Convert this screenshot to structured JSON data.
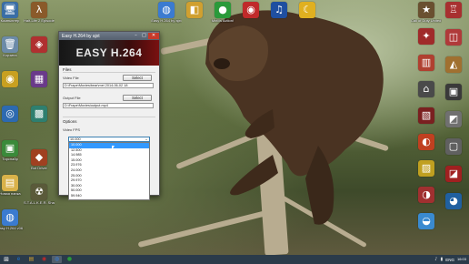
{
  "window": {
    "title": "Easy H.264 by ajxt",
    "banner_text": "EASY H.264",
    "minimize_glyph": "–",
    "maximize_glyph": "□",
    "close_glyph": "✕",
    "files_group": "Files",
    "video_file_label": "Video File",
    "video_file_value": "D:\\Frape\\Movies\\bear\\mei 2014-06-02 18",
    "select_label": "Select",
    "output_file_label": "Output File",
    "output_file_value": "D:\\Frape\\Movies\\output.mp4",
    "options_group": "Options",
    "video_fps_label": "Video FPS",
    "fps_selected": "10.000",
    "fps_arrow": "⌄",
    "fps_options": [
      "10.000",
      "12.500",
      "14.985",
      "15.000",
      "23.976",
      "24.000",
      "25.000",
      "29.970",
      "30.000",
      "50.000",
      "59.940"
    ],
    "fps_highlight_index": 0
  },
  "desktop": {
    "left_icons": [
      {
        "label": "Компьютер",
        "glyph": "🖥",
        "color": "#3a6ea5",
        "icon": "computer-icon"
      },
      {
        "label": "Корзина",
        "glyph": "🗑",
        "color": "#6c8ba8",
        "icon": "recycle-bin-icon"
      },
      {
        "label": "",
        "glyph": "◉",
        "color": "#c8a020",
        "icon": "app-icon"
      },
      {
        "label": "",
        "glyph": "◎",
        "color": "#2d6ab0",
        "icon": "app-icon"
      },
      {
        "label": "Тирснайр",
        "glyph": "▣",
        "color": "#3a8a3a",
        "icon": "app-icon"
      },
      {
        "label": "Новая папка",
        "glyph": "▤",
        "color": "#d9b24a",
        "icon": "folder-icon"
      },
      {
        "label": "Easy H.264 v06",
        "glyph": "◍",
        "color": "#3b7bd0",
        "icon": "easy-h264-icon"
      }
    ],
    "left_icons_col2": [
      {
        "label": "Half-Life 2 Episode...",
        "glyph": "λ",
        "color": "#8a5a2a",
        "icon": "game-icon"
      },
      {
        "label": "",
        "glyph": "◈",
        "color": "#b03030",
        "icon": "app-icon"
      },
      {
        "label": "",
        "glyph": "▦",
        "color": "#6a3a8a",
        "icon": "app-icon"
      },
      {
        "label": "",
        "glyph": "▩",
        "color": "#2f7f6f",
        "icon": "app-icon"
      },
      {
        "label": "Bot Driver",
        "glyph": "◆",
        "color": "#a04020",
        "icon": "app-icon"
      },
      {
        "label": "S.T.A.L.K.E.R. Shadow of...",
        "glyph": "☢",
        "color": "#5a5a3a",
        "icon": "game-icon"
      }
    ],
    "top_icons": [
      {
        "label": "Easy H.264 by ajxt",
        "glyph": "◍",
        "color": "#3b7bd0",
        "icon": "easy-h264-icon"
      },
      {
        "label": "",
        "glyph": "◧",
        "color": "#d0a030",
        "icon": "app-icon"
      },
      {
        "label": "Mirillis Action!",
        "glyph": "●",
        "color": "#2a9a3a",
        "icon": "recorder-icon"
      },
      {
        "label": "",
        "glyph": "◉",
        "color": "#c02a2a",
        "icon": "app-icon"
      },
      {
        "label": "",
        "glyph": "♫",
        "color": "#1f4fa0",
        "icon": "media-icon"
      },
      {
        "label": "",
        "glyph": "☾",
        "color": "#e0b020",
        "icon": "app-icon"
      }
    ],
    "right_icons": [
      {
        "label": "Call of Duty United Offen...",
        "glyph": "★",
        "color": "#6a5030",
        "icon": "game-icon"
      },
      {
        "label": "",
        "glyph": "✦",
        "color": "#a02a2a",
        "icon": "game-icon"
      },
      {
        "label": "",
        "glyph": "▥",
        "color": "#b04030",
        "icon": "app-icon"
      },
      {
        "label": "",
        "glyph": "⌂",
        "color": "#4a4a4a",
        "icon": "app-icon"
      },
      {
        "label": "",
        "glyph": "▧",
        "color": "#7a2020",
        "icon": "app-icon"
      },
      {
        "label": "",
        "glyph": "◐",
        "color": "#c04020",
        "icon": "app-icon"
      },
      {
        "label": "",
        "glyph": "▨",
        "color": "#c0a020",
        "icon": "app-icon"
      },
      {
        "label": "",
        "glyph": "◑",
        "color": "#a03030",
        "icon": "app-icon"
      },
      {
        "label": "",
        "glyph": "◒",
        "color": "#3a8ad0",
        "icon": "app-icon"
      }
    ],
    "right_icons_col2": [
      {
        "label": "",
        "glyph": "♖",
        "color": "#a83030",
        "icon": "app-icon"
      },
      {
        "label": "",
        "glyph": "◫",
        "color": "#b03a3a",
        "icon": "app-icon"
      },
      {
        "label": "",
        "glyph": "◭",
        "color": "#a07030",
        "icon": "app-icon"
      },
      {
        "label": "",
        "glyph": "▣",
        "color": "#3a3a3a",
        "icon": "app-icon"
      },
      {
        "label": "",
        "glyph": "◩",
        "color": "#707070",
        "icon": "app-icon"
      },
      {
        "label": "",
        "glyph": "▢",
        "color": "#606060",
        "icon": "app-icon"
      },
      {
        "label": "",
        "glyph": "◪",
        "color": "#a02020",
        "icon": "app-icon"
      },
      {
        "label": "",
        "glyph": "◕",
        "color": "#2060a0",
        "icon": "app-icon"
      }
    ]
  },
  "taskbar": {
    "start_glyph": "⊞",
    "items": [
      {
        "glyph": "e",
        "color": "#1e6fc7",
        "icon": "ie-icon"
      },
      {
        "glyph": "▤",
        "color": "#d0a030",
        "icon": "explorer-icon"
      },
      {
        "glyph": "◉",
        "color": "#c02a2a",
        "icon": "app-icon"
      },
      {
        "glyph": "◍",
        "color": "#3b7bd0",
        "icon": "easy-h264-icon"
      },
      {
        "glyph": "●",
        "color": "#2a9a3a",
        "icon": "recorder-icon"
      }
    ],
    "lang": "ENG",
    "time": "16:03"
  }
}
